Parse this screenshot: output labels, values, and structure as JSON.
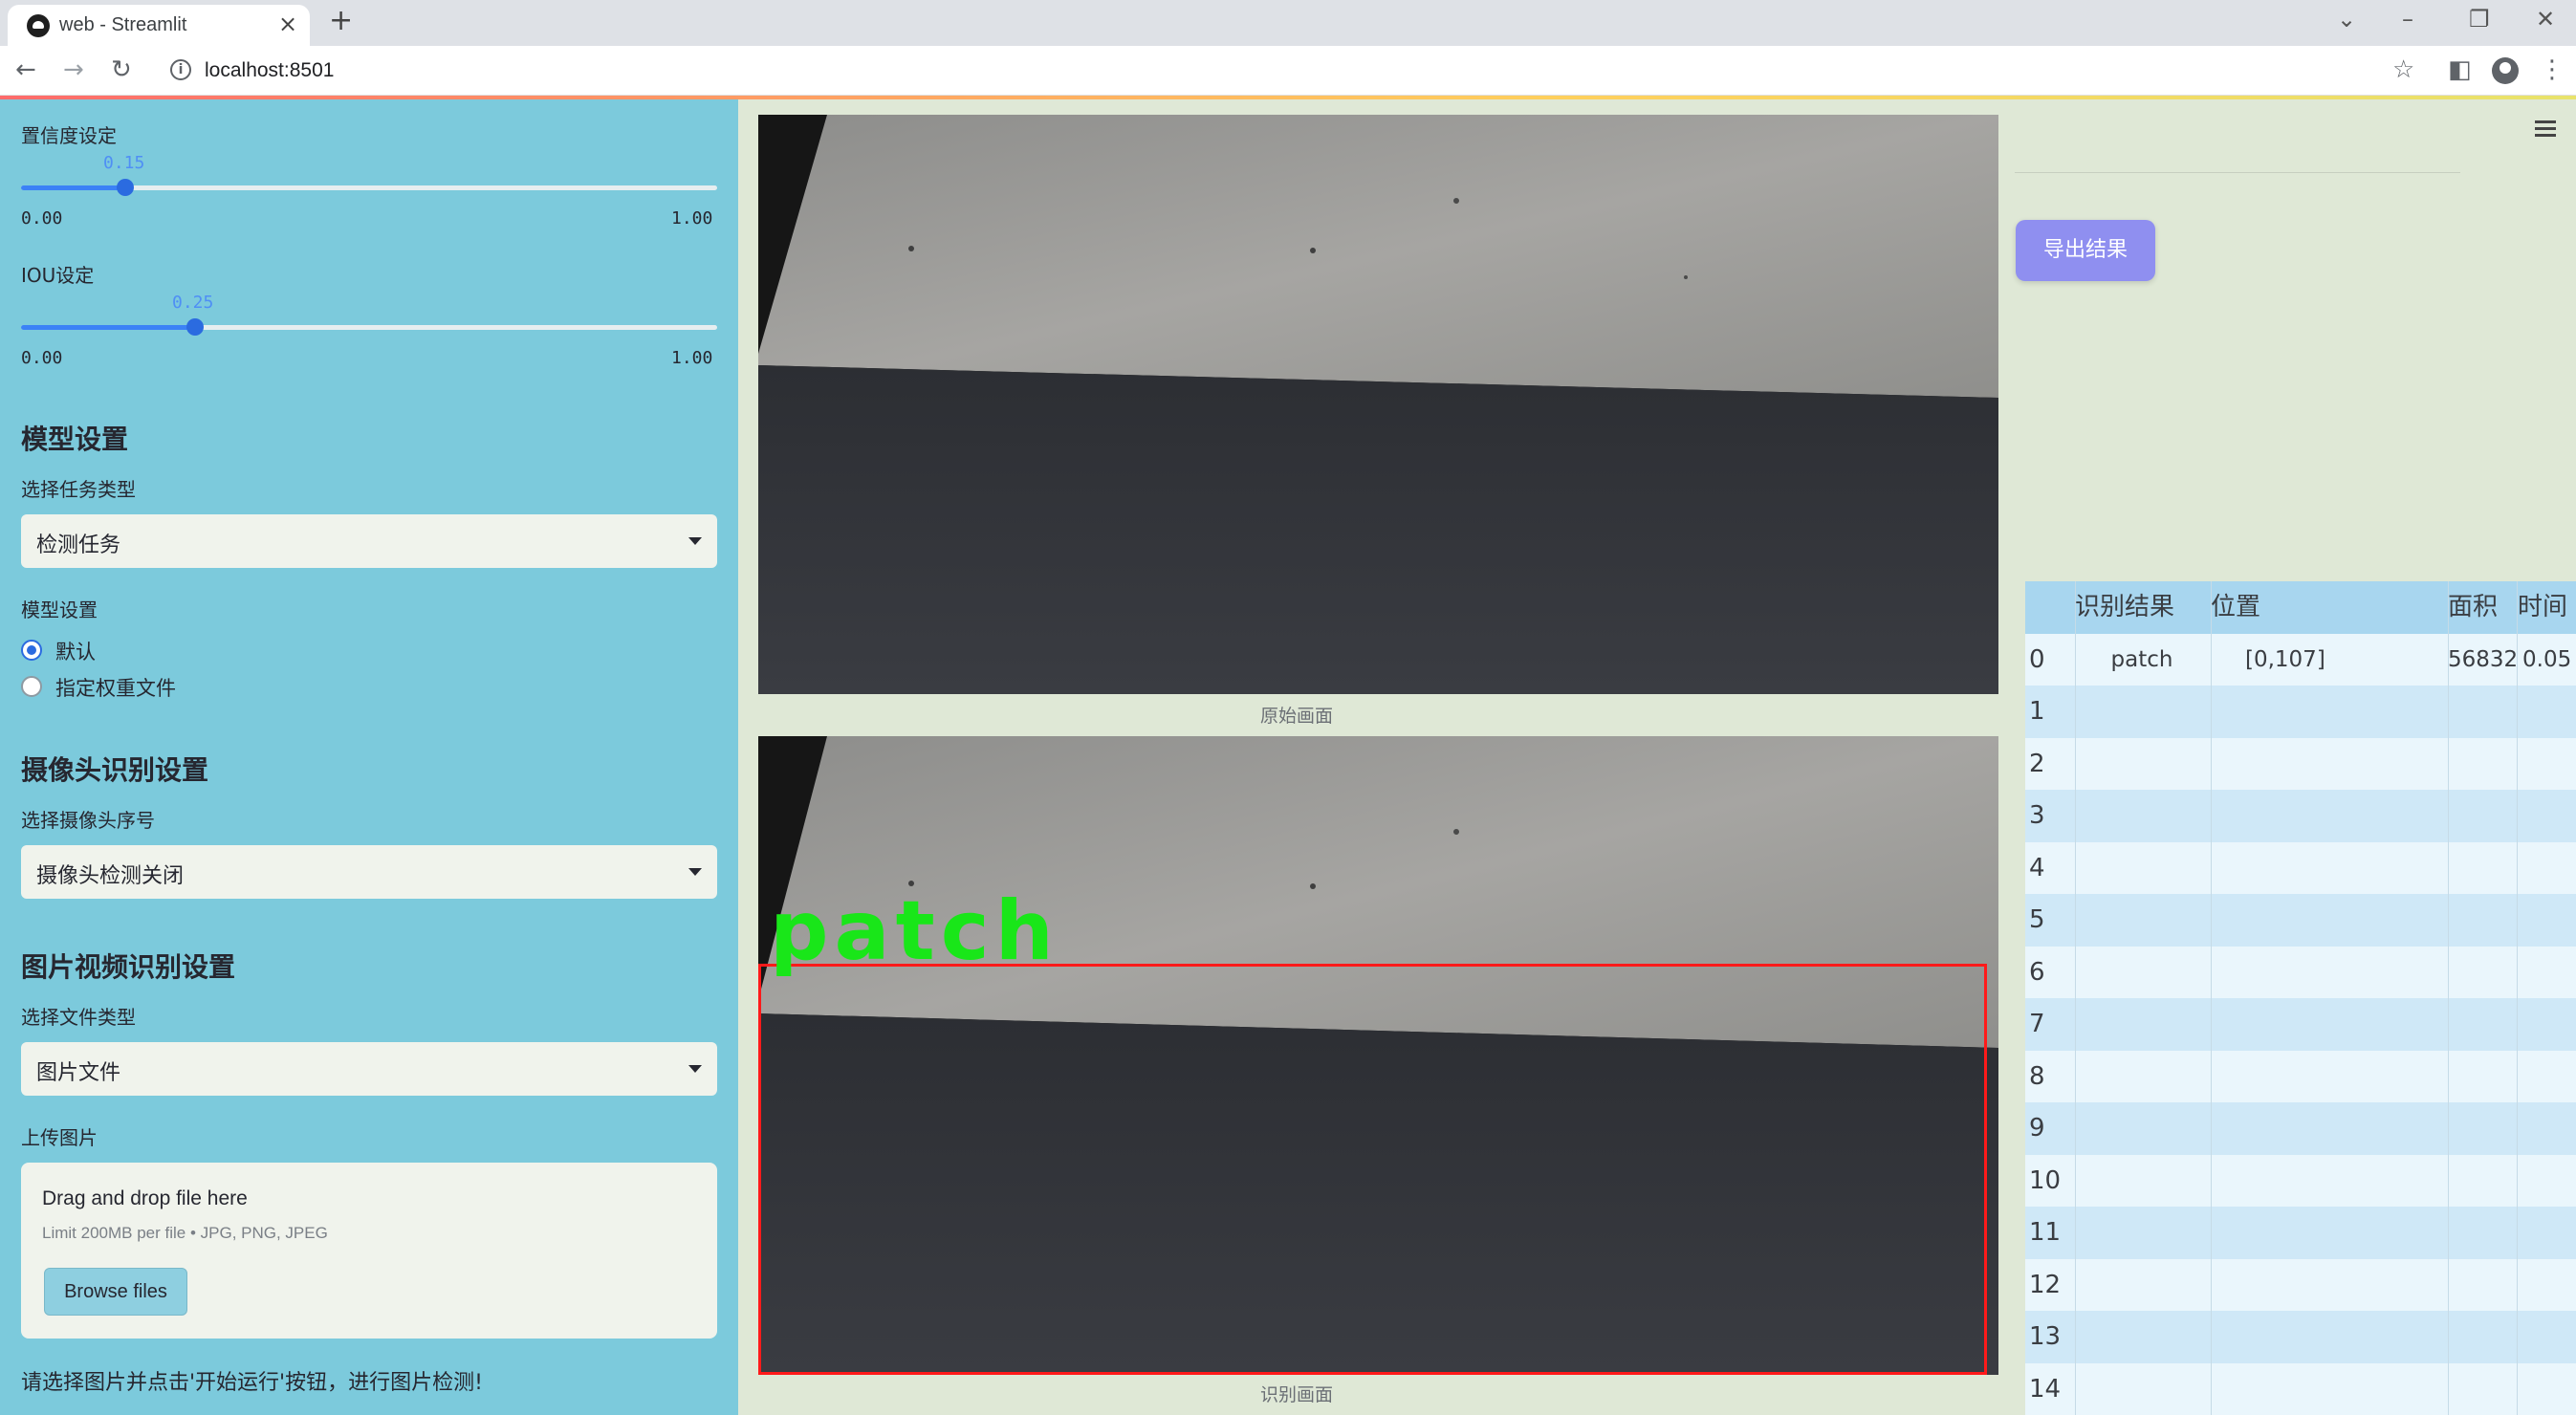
{
  "browser": {
    "tab_title": "web - Streamlit",
    "url": "localhost:8501"
  },
  "sidebar": {
    "confidence": {
      "label": "置信度设定",
      "value": "0.15",
      "value_num": 0.15,
      "min": "0.00",
      "max": "1.00"
    },
    "iou": {
      "label": "IOU设定",
      "value": "0.25",
      "value_num": 0.25,
      "min": "0.00",
      "max": "1.00"
    },
    "model_section": {
      "title": "模型设置",
      "task_label": "选择任务类型",
      "task_value": "检测任务",
      "model_label": "模型设置",
      "radio_default": "默认",
      "radio_custom": "指定权重文件",
      "selected": "默认"
    },
    "camera_section": {
      "title": "摄像头识别设置",
      "camera_label": "选择摄像头序号",
      "camera_value": "摄像头检测关闭"
    },
    "media_section": {
      "title": "图片视频识别设置",
      "filetype_label": "选择文件类型",
      "filetype_value": "图片文件",
      "upload_label": "上传图片",
      "drop_title": "Drag and drop file here",
      "drop_limit": "Limit 200MB per file • JPG, PNG, JPEG",
      "browse_label": "Browse files"
    },
    "status_message": "请选择图片并点击'开始运行'按钮，进行图片检测!"
  },
  "main": {
    "original_caption": "原始画面",
    "detected_caption": "识别画面",
    "detection_label": "patch",
    "box_color": "#ff1a1a",
    "label_color": "#19e619"
  },
  "right": {
    "export_label": "导出结果",
    "table": {
      "headers": [
        "",
        "识别结果",
        "位置",
        "面积",
        "时间"
      ],
      "rows": [
        [
          "0",
          "patch",
          "[0,107]",
          "56832",
          "0.05"
        ],
        [
          "1",
          "",
          "",
          "",
          ""
        ],
        [
          "2",
          "",
          "",
          "",
          ""
        ],
        [
          "3",
          "",
          "",
          "",
          ""
        ],
        [
          "4",
          "",
          "",
          "",
          ""
        ],
        [
          "5",
          "",
          "",
          "",
          ""
        ],
        [
          "6",
          "",
          "",
          "",
          ""
        ],
        [
          "7",
          "",
          "",
          "",
          ""
        ],
        [
          "8",
          "",
          "",
          "",
          ""
        ],
        [
          "9",
          "",
          "",
          "",
          ""
        ],
        [
          "10",
          "",
          "",
          "",
          ""
        ],
        [
          "11",
          "",
          "",
          "",
          ""
        ],
        [
          "12",
          "",
          "",
          "",
          ""
        ],
        [
          "13",
          "",
          "",
          "",
          ""
        ],
        [
          "14",
          "",
          "",
          "",
          ""
        ]
      ]
    }
  },
  "icons": [
    "streamlit-favicon",
    "close-icon",
    "plus-icon",
    "back-icon",
    "forward-icon",
    "reload-icon",
    "info-icon",
    "star-icon",
    "sidepanel-icon",
    "profile-icon",
    "menu-dots-icon",
    "hamburger-icon"
  ]
}
